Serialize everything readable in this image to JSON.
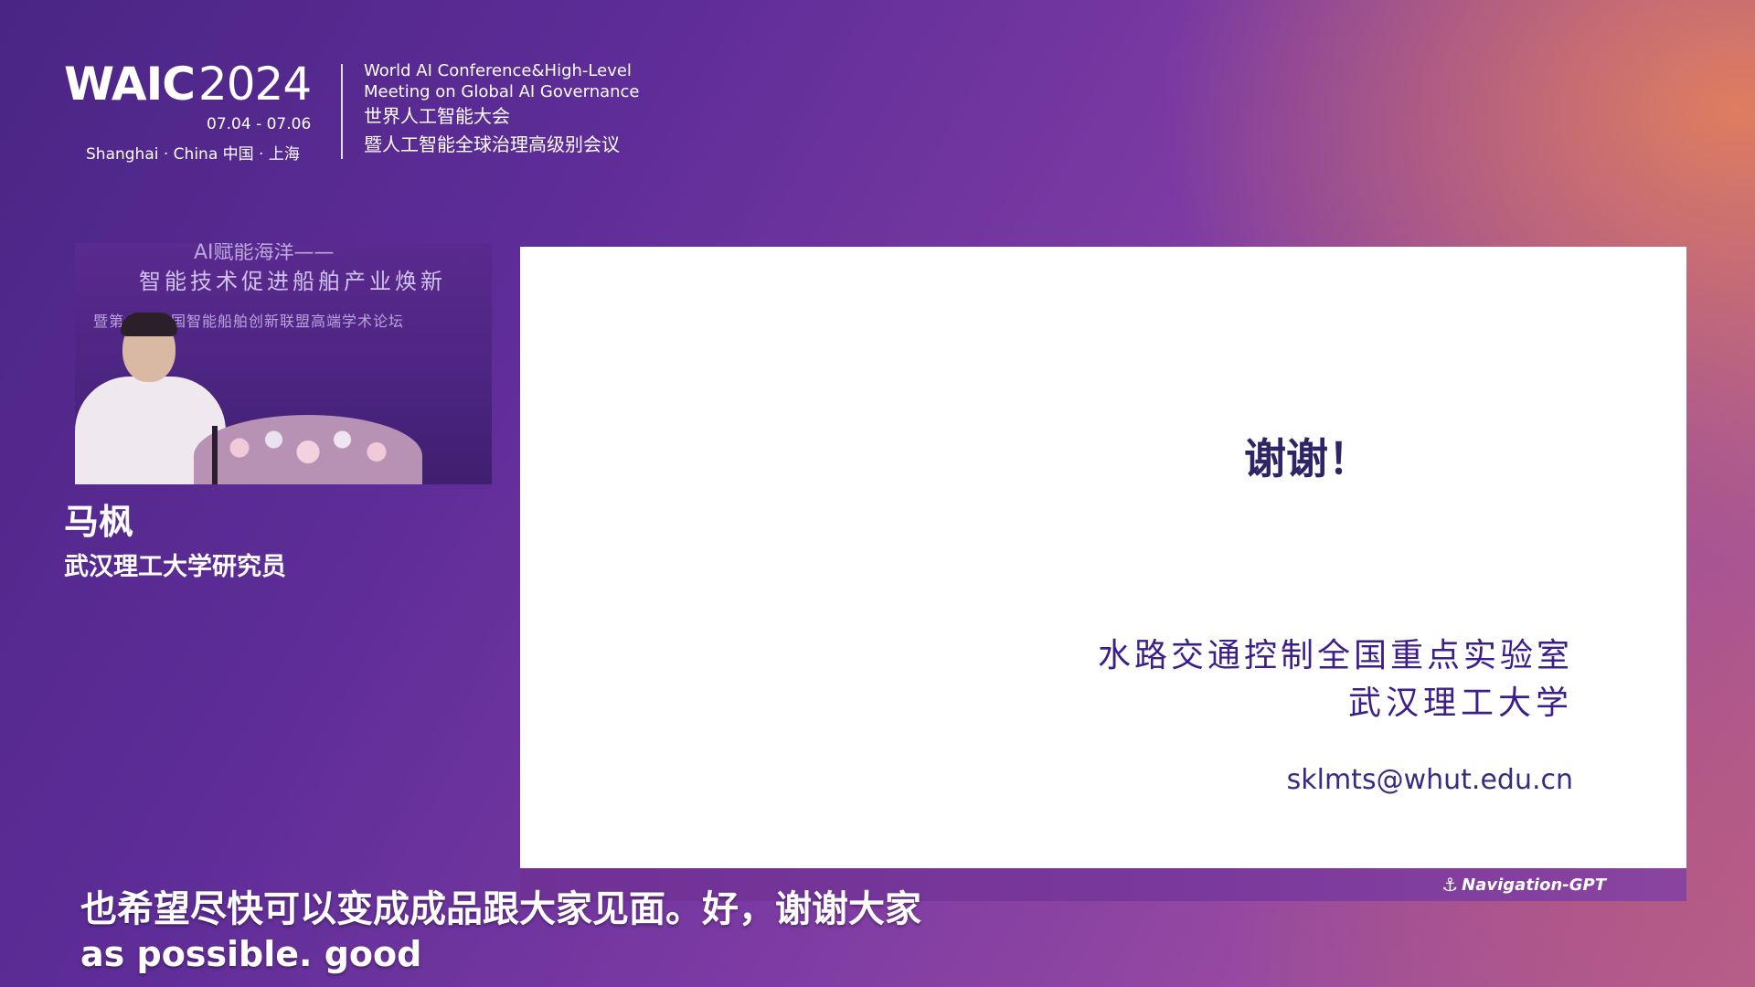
{
  "conference": {
    "logo_waic": "WAIC",
    "logo_year": "2024",
    "dates": "07.04 - 07.06",
    "city": "Shanghai · China  中国 · 上海",
    "title_en_line1": "World AI Conference&High-Level",
    "title_en_line2": "Meeting on Global AI Governance",
    "title_cn_line1": "世界人工智能大会",
    "title_cn_line2": "暨人工智能全球治理高级别会议"
  },
  "video": {
    "banner_line1": "AI赋能海洋——",
    "banner_line2": "智能技术促进船舶产业焕新",
    "banner_line3": "暨第六届中国智能船舶创新联盟高端学术论坛"
  },
  "speaker": {
    "name": "马枫",
    "title": "武汉理工大学研究员"
  },
  "slide": {
    "thanks": "谢谢！",
    "lab": "水路交通控制全国重点实验室",
    "university": "武汉理工大学",
    "email": "sklmts@whut.edu.cn",
    "footer_brand": "Navigation-GPT",
    "footer_icon": "anchor-icon"
  },
  "subtitles": {
    "chinese": "也希望尽快可以变成成品跟大家见面。好，谢谢大家",
    "english": "as possible. good"
  }
}
